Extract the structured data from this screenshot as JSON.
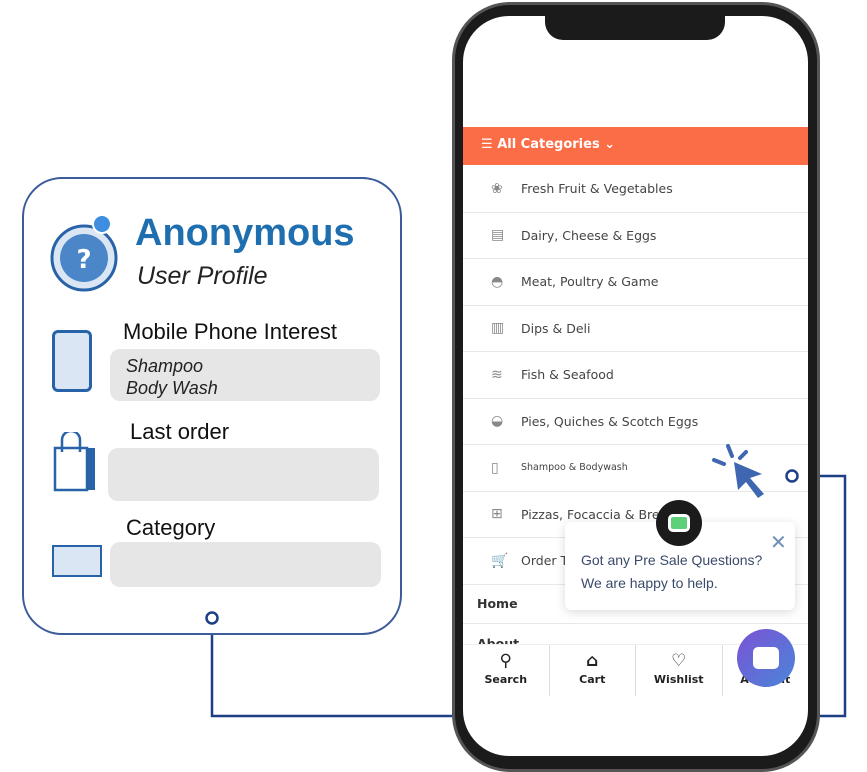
{
  "profile": {
    "title": "Anonymous",
    "subtitle": "User Profile",
    "sections": [
      {
        "label": "Mobile Phone Interest",
        "values": [
          "Shampoo",
          "Body Wash"
        ]
      },
      {
        "label": "Last order",
        "values": []
      },
      {
        "label": "Category",
        "values": []
      }
    ]
  },
  "phone": {
    "category_bar": "All Categories",
    "categories": [
      "Fresh Fruit & Vegetables",
      "Dairy, Cheese & Eggs",
      "Meat, Poultry & Game",
      "Dips & Deli",
      "Fish & Seafood",
      "Pies, Quiches & Scotch Eggs",
      "Shampoo & Bodywash",
      "Pizzas, Focaccia & Bread",
      "Order T"
    ],
    "menu": [
      "Home",
      "About"
    ],
    "nav": [
      {
        "label": "Search",
        "icon": "search-icon"
      },
      {
        "label": "Cart",
        "icon": "basket-icon"
      },
      {
        "label": "Wishlist",
        "icon": "heart-icon"
      },
      {
        "label": "Account",
        "icon": "user-icon"
      }
    ]
  },
  "chat": {
    "message": "Got any Pre Sale Questions? We are happy to help."
  },
  "colors": {
    "accent": "#fb6d47",
    "brand": "#1f6fb0",
    "line": "#1d3f86",
    "chat": "#6a5bd6"
  }
}
